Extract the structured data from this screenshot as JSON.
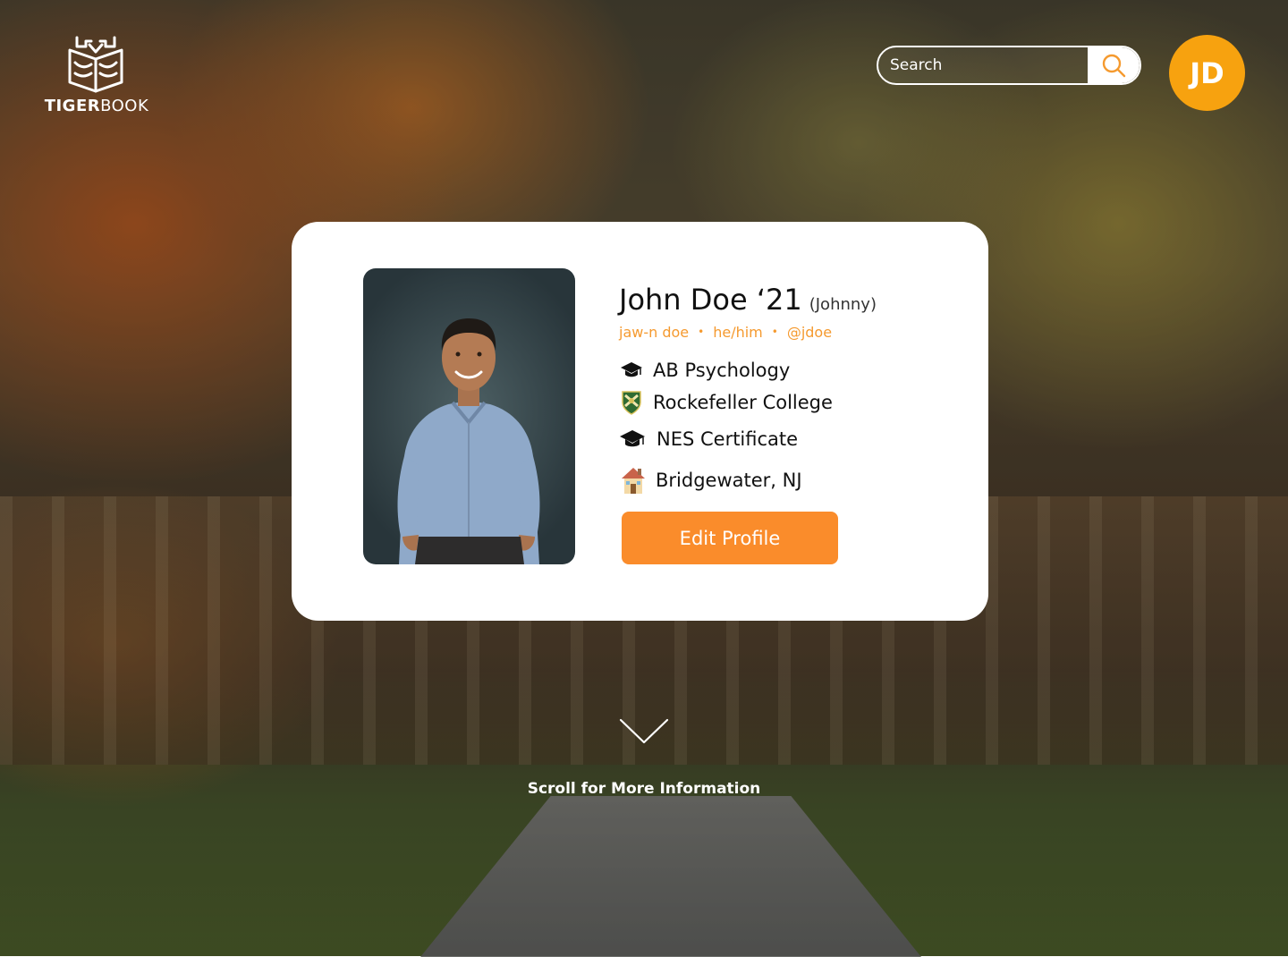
{
  "brand": {
    "name_bold": "TIGER",
    "name_regular": "BOOK",
    "logo_icon": "tiger-book-icon"
  },
  "search": {
    "placeholder": "Search",
    "value": "",
    "icon": "search-icon"
  },
  "user": {
    "initials": "JD"
  },
  "profile": {
    "name": "John Doe ‘21",
    "nickname": "(Johnny)",
    "pronunciation": "jaw-n doe",
    "pronouns": "he/him",
    "handle": "@jdoe",
    "separator": "•",
    "details": [
      {
        "icon": "graduation-cap-icon",
        "text": "AB Psychology"
      },
      {
        "icon": "college-shield-icon",
        "text": "Rockefeller College"
      },
      {
        "icon": "graduation-cap-icon",
        "text": "NES Certificate"
      },
      {
        "icon": "house-icon",
        "text": "Bridgewater, NJ"
      }
    ],
    "edit_label": "Edit Profile"
  },
  "scroll": {
    "label": "Scroll for More Information",
    "icon": "chevron-down-icon"
  },
  "colors": {
    "accent": "#fa8c2b",
    "avatar": "#f7a20f",
    "meta_text": "#f59a2f"
  }
}
